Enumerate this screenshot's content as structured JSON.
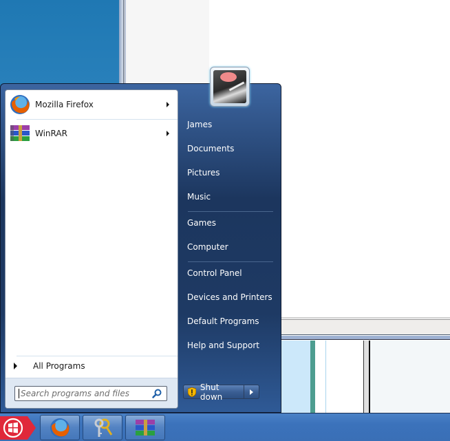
{
  "start_menu": {
    "pinned_programs": [
      {
        "label": "Mozilla Firefox",
        "icon": "firefox-icon",
        "has_submenu": true
      },
      {
        "label": "WinRAR",
        "icon": "winrar-icon",
        "has_submenu": true
      }
    ],
    "all_programs_label": "All Programs",
    "search": {
      "placeholder": "Search programs and files",
      "value": ""
    },
    "user_picture": "turntable-user-picture",
    "right_items": [
      {
        "label": "James"
      },
      {
        "label": "Documents"
      },
      {
        "label": "Pictures"
      },
      {
        "label": "Music"
      },
      {
        "label": "Games"
      },
      {
        "label": "Computer"
      },
      {
        "label": "Control Panel"
      },
      {
        "label": "Devices and Printers"
      },
      {
        "label": "Default Programs"
      },
      {
        "label": "Help and Support"
      }
    ],
    "shutdown": {
      "label": "Shut down",
      "icon": "shield-warning-icon",
      "options_icon": "chevron-right-icon"
    }
  },
  "taskbar": {
    "start_button": "windows-logo-icon",
    "pinned": [
      {
        "name": "Mozilla Firefox",
        "icon": "firefox-icon"
      },
      {
        "name": "Keys",
        "icon": "keys-icon"
      },
      {
        "name": "WinRAR",
        "icon": "winrar-icon"
      }
    ]
  },
  "colors": {
    "menu_blue_top": "#3c65a0",
    "menu_blue_mid": "#1c365e",
    "taskbar_blue": "#3b72bb",
    "start_orb_red": "#e0283a"
  }
}
